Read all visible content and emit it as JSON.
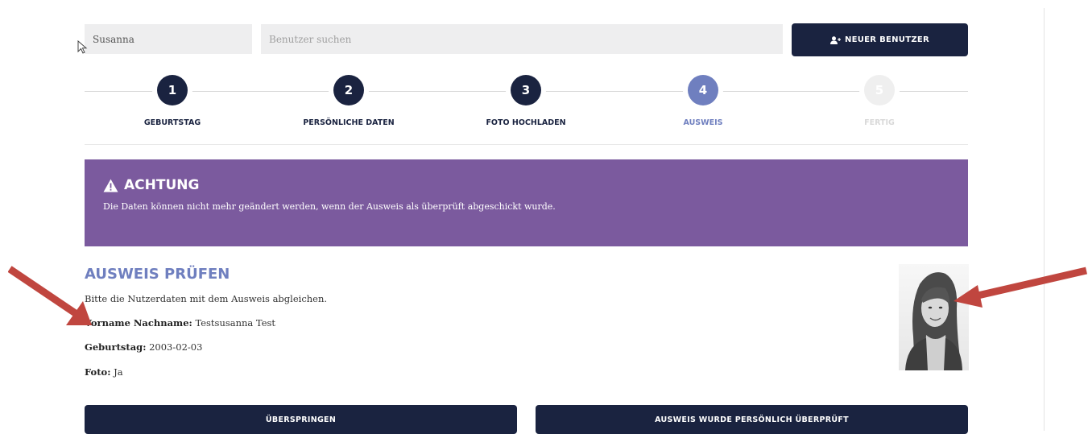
{
  "header": {
    "user_value": "Susanna",
    "search_placeholder": "Benutzer suchen",
    "new_user_label": "NEUER BENUTZER"
  },
  "steps": [
    {
      "number": "1",
      "label": "GEBURTSTAG",
      "state": "done"
    },
    {
      "number": "2",
      "label": "PERSÖNLICHE DATEN",
      "state": "done"
    },
    {
      "number": "3",
      "label": "FOTO HOCHLADEN",
      "state": "done"
    },
    {
      "number": "4",
      "label": "AUSWEIS",
      "state": "current"
    },
    {
      "number": "5",
      "label": "FERTIG",
      "state": "todo"
    }
  ],
  "alert": {
    "icon": "warning-icon",
    "title": "ACHTUNG",
    "text": "Die Daten können nicht mehr geändert werden, wenn der Ausweis als überprüft abgeschickt wurde.",
    "color": "#7b5a9e"
  },
  "verify": {
    "title": "AUSWEIS PRÜFEN",
    "instruction": "Bitte die Nutzerdaten mit dem Ausweis abgleichen.",
    "name_label": "Vorname Nachname:",
    "name_value": "Testsusanna Test",
    "birthday_label": "Geburtstag:",
    "birthday_value": "2003-02-03",
    "photo_label": "Foto:",
    "photo_value": "Ja"
  },
  "actions": {
    "skip_label": "ÜBERSPRINGEN",
    "verified_label": "AUSWEIS WURDE PERSÖNLICH ÜBERPRÜFT"
  },
  "colors": {
    "navy": "#1a2340",
    "accent": "#6f7fbf",
    "alert": "#7b5a9e",
    "annotation_arrow": "#c0463f"
  }
}
